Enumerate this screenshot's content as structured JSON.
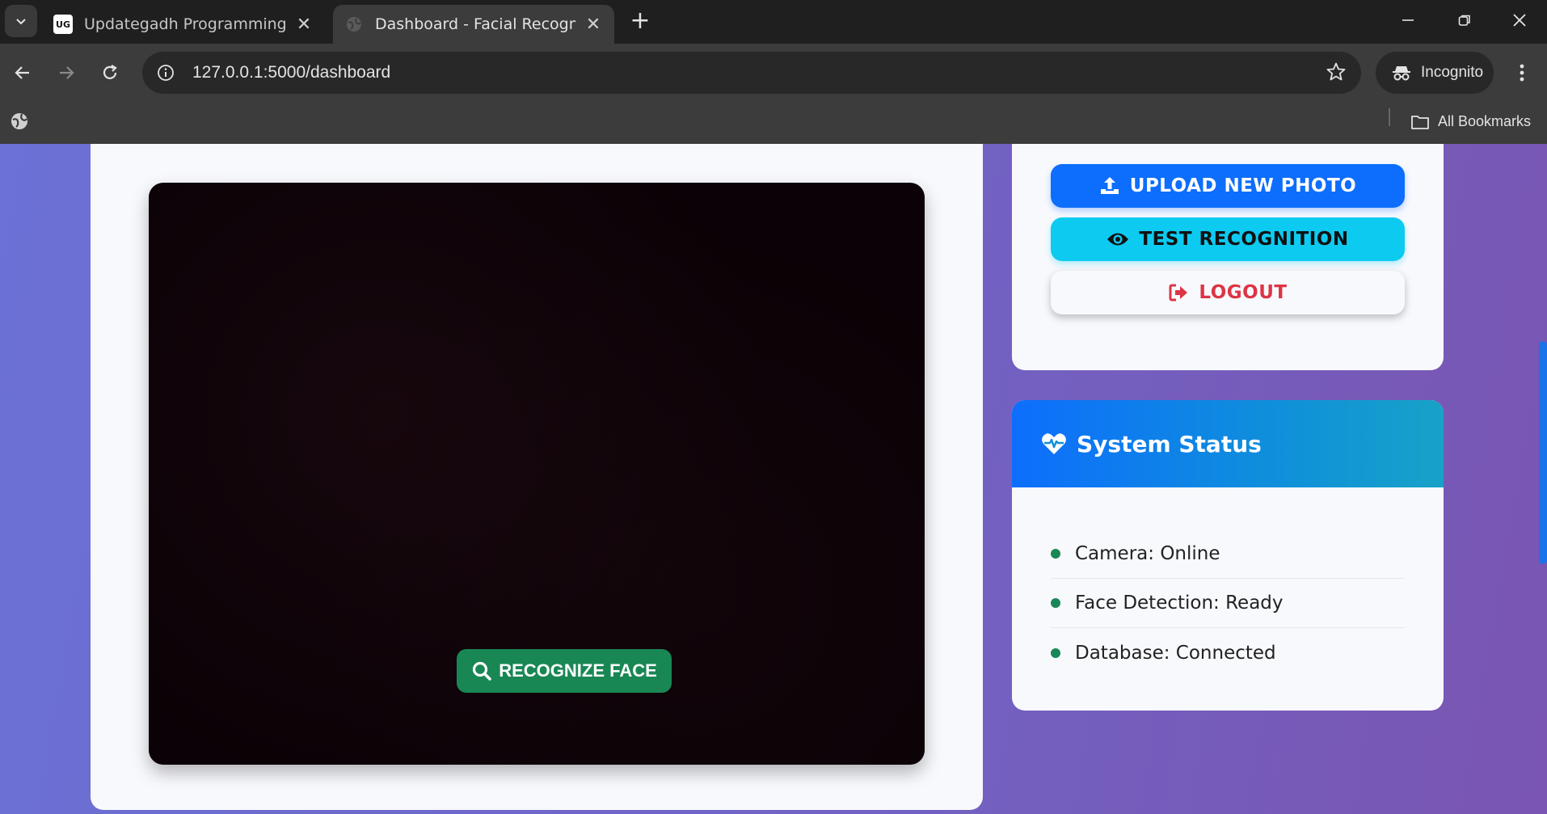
{
  "browser": {
    "tabs": [
      {
        "title": "Updategadh Programming - Up",
        "favicon_text": "UG",
        "active": false
      },
      {
        "title": "Dashboard - Facial Recognition",
        "active": true
      }
    ],
    "url": "127.0.0.1:5000/dashboard",
    "incognito_label": "Incognito",
    "bookmarks_label": "All Bookmarks",
    "icons": [
      "tab-search-icon",
      "close-icon",
      "plus-icon",
      "minimize-icon",
      "restore-icon",
      "back-icon",
      "forward-icon",
      "reload-icon",
      "info-icon",
      "star-icon",
      "incognito-icon",
      "kebab-menu-icon",
      "globe-icon",
      "folder-icon"
    ]
  },
  "main": {
    "recognize_button": "RECOGNIZE FACE"
  },
  "actions": {
    "upload": "UPLOAD NEW PHOTO",
    "test": "TEST RECOGNITION",
    "logout": "LOGOUT"
  },
  "status": {
    "title": "System Status",
    "items": [
      {
        "label": "Camera: Online"
      },
      {
        "label": "Face Detection: Ready"
      },
      {
        "label": "Database: Connected"
      }
    ]
  },
  "colors": {
    "primary": "#0d6efd",
    "info": "#0dcaf0",
    "success": "#198754",
    "danger": "#dc3545",
    "page_bg": "#6f68cc"
  }
}
